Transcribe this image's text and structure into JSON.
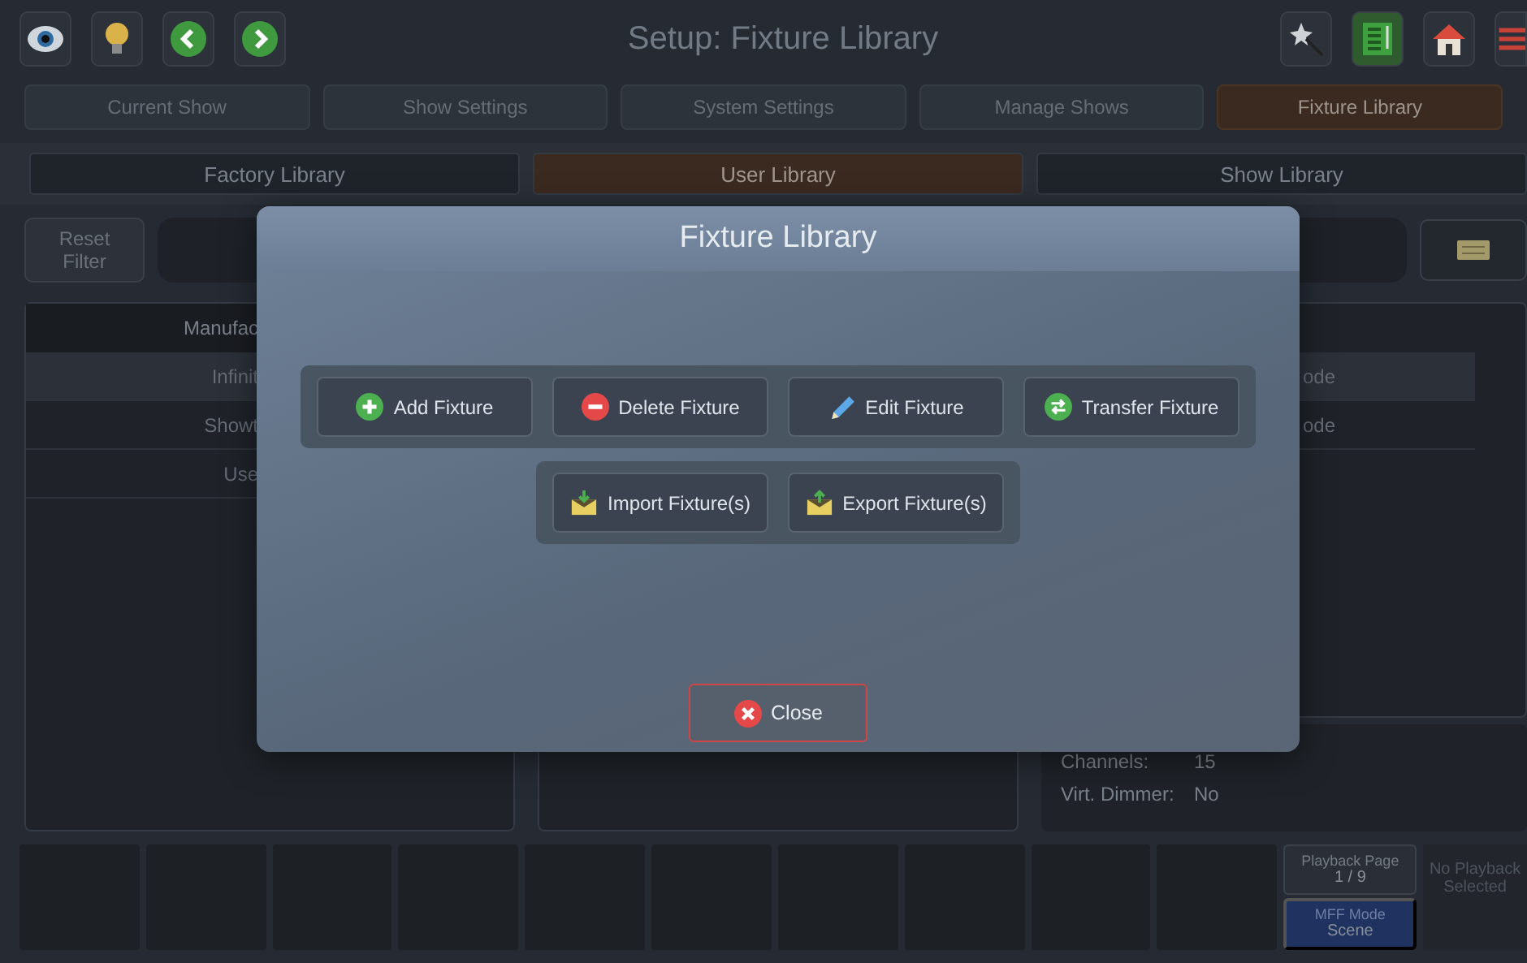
{
  "header": {
    "title": "Setup: Fixture Library"
  },
  "tabs": [
    {
      "label": "Current Show",
      "selected": false
    },
    {
      "label": "Show Settings",
      "selected": false
    },
    {
      "label": "System Settings",
      "selected": false
    },
    {
      "label": "Manage Shows",
      "selected": false
    },
    {
      "label": "Fixture Library",
      "selected": true
    }
  ],
  "library_tabs": [
    {
      "label": "Factory Library",
      "selected": false
    },
    {
      "label": "User Library",
      "selected": true
    },
    {
      "label": "Show Library",
      "selected": false
    }
  ],
  "filter": {
    "reset_label": "Reset Filter"
  },
  "manufacturers": {
    "header": "Manufac",
    "rows": [
      {
        "label": "Infinit",
        "selected": true
      },
      {
        "label": "Showt",
        "selected": false
      },
      {
        "label": "Use",
        "selected": false
      }
    ]
  },
  "modes": {
    "rows": [
      {
        "label": "ode",
        "selected": true
      },
      {
        "label": "ode",
        "selected": false
      }
    ]
  },
  "info": [
    {
      "label": "Channels:",
      "value": "15"
    },
    {
      "label": "Virt. Dimmer:",
      "value": "No"
    }
  ],
  "playback": {
    "page_label": "Playback Page",
    "page_value": "1 / 9",
    "mode_label": "MFF Mode",
    "mode_value": "Scene",
    "status": "No Playback Selected"
  },
  "dialog": {
    "title": "Fixture Library",
    "groups": [
      [
        {
          "label": "Add Fixture",
          "kind": "add"
        },
        {
          "label": "Delete Fixture",
          "kind": "delete"
        },
        {
          "label": "Edit Fixture",
          "kind": "edit"
        },
        {
          "label": "Transfer Fixture",
          "kind": "transfer"
        }
      ],
      [
        {
          "label": "Import Fixture(s)",
          "kind": "import"
        },
        {
          "label": "Export Fixture(s)",
          "kind": "export"
        }
      ]
    ],
    "close_label": "Close"
  }
}
